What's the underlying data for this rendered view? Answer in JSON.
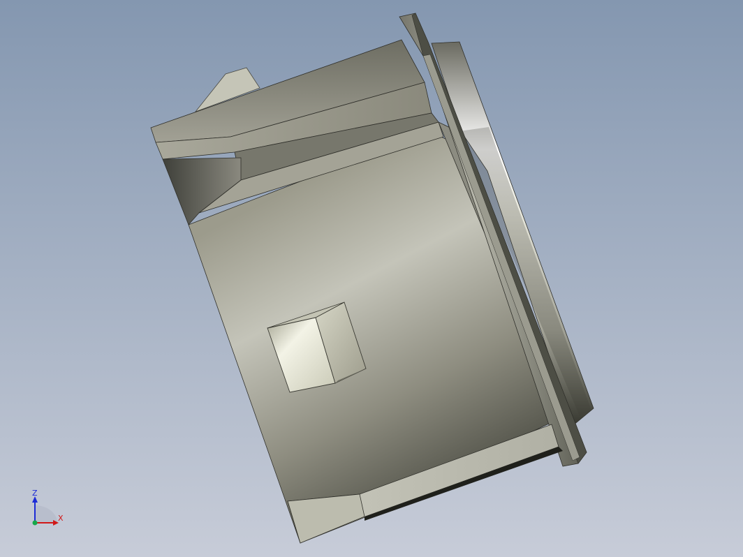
{
  "viewport": {
    "background_top": "#8497b0",
    "background_bottom": "#c7ccd8"
  },
  "triad": {
    "z_label": "Z",
    "x_label": "X",
    "z_color": "#1c2bd6",
    "x_color": "#d11818",
    "y_color": "#16a84a"
  }
}
